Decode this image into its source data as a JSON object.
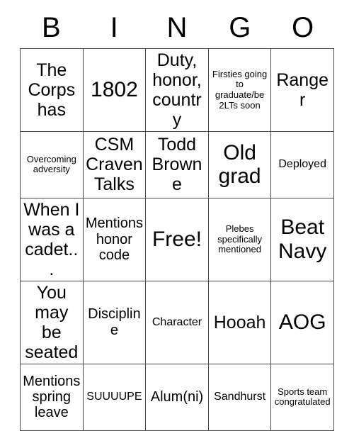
{
  "card": {
    "header_letters": [
      "B",
      "I",
      "N",
      "G",
      "O"
    ],
    "rows": [
      [
        {
          "text": "The Corps has",
          "size": "fs-lg"
        },
        {
          "text": "1802",
          "size": "fs-xl"
        },
        {
          "text": "Duty, honor, country",
          "size": "fs-lg"
        },
        {
          "text": "Firsties going to graduate/be 2LTs soon",
          "size": "fs-xs"
        },
        {
          "text": "Ranger",
          "size": "fs-lg"
        }
      ],
      [
        {
          "text": "Overcoming adversity",
          "size": "fs-xs"
        },
        {
          "text": "CSM Craven Talks",
          "size": "fs-lg"
        },
        {
          "text": "Todd Browne",
          "size": "fs-lg"
        },
        {
          "text": "Old grad",
          "size": "fs-xl"
        },
        {
          "text": "Deployed",
          "size": "fs-sm"
        }
      ],
      [
        {
          "text": "When I was a cadet...",
          "size": "fs-lg"
        },
        {
          "text": "Mentions honor code",
          "size": "fs-md"
        },
        {
          "text": "Free!",
          "size": "fs-xl"
        },
        {
          "text": "Plebes specifically mentioned",
          "size": "fs-xs"
        },
        {
          "text": "Beat Navy",
          "size": "fs-xl"
        }
      ],
      [
        {
          "text": "You may be seated",
          "size": "fs-lg"
        },
        {
          "text": "Discipline",
          "size": "fs-md"
        },
        {
          "text": "Character",
          "size": "fs-sm"
        },
        {
          "text": "Hooah",
          "size": "fs-lg"
        },
        {
          "text": "AOG",
          "size": "fs-xl"
        }
      ],
      [
        {
          "text": "Mentions spring leave",
          "size": "fs-md"
        },
        {
          "text": "SUUUUPE",
          "size": "fs-sm"
        },
        {
          "text": "Alum(ni)",
          "size": "fs-md"
        },
        {
          "text": "Sandhurst",
          "size": "fs-sm"
        },
        {
          "text": "Sports team congratulated",
          "size": "fs-xs"
        }
      ]
    ]
  }
}
